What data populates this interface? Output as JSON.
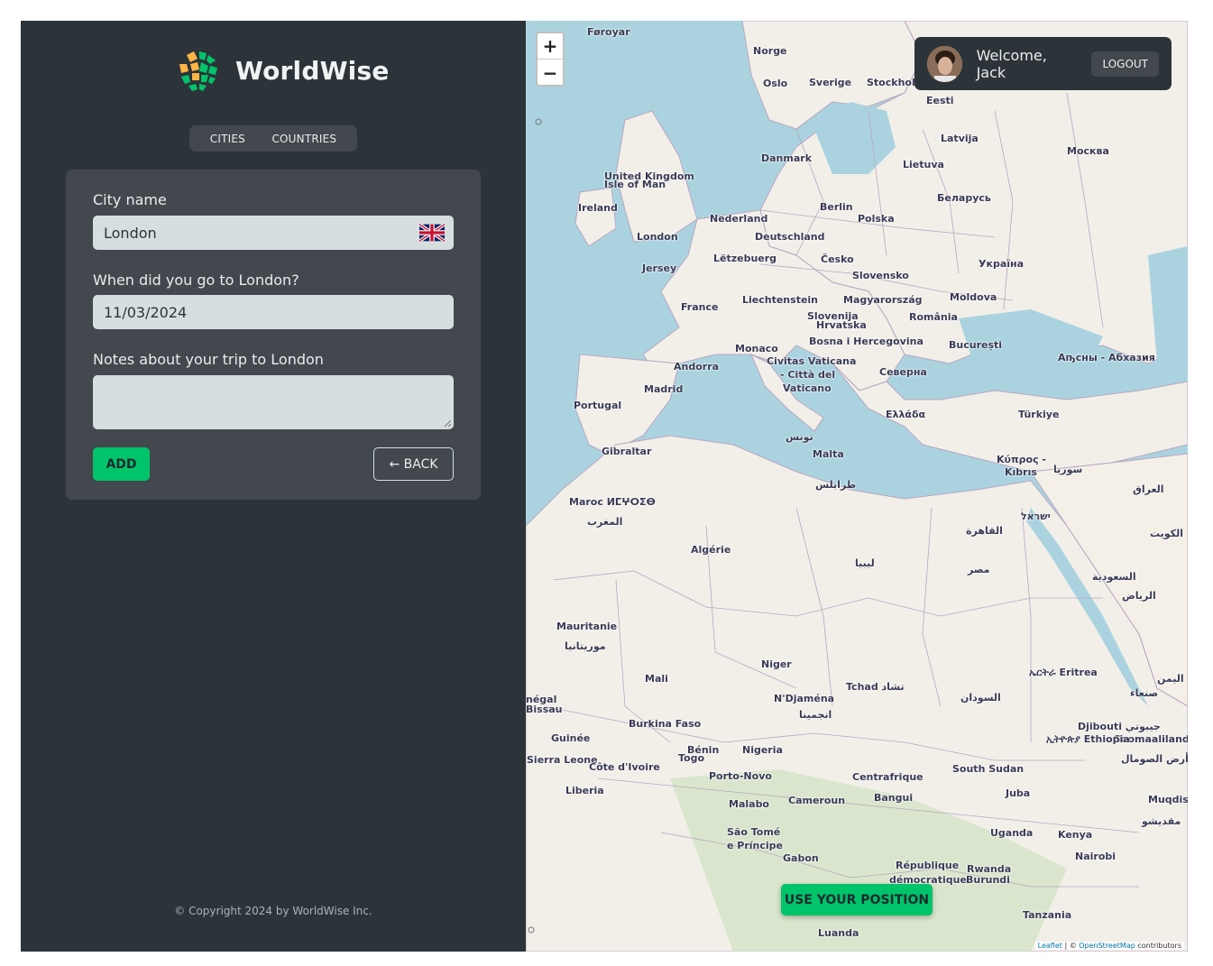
{
  "app": {
    "brand": "WorldWise",
    "nav": {
      "cities": "CITIES",
      "countries": "COUNTRIES"
    },
    "copyright": "© Copyright 2024 by WorldWise Inc."
  },
  "form": {
    "city_label": "City name",
    "city_value": "London",
    "date_label": "When did you go to London?",
    "date_value": "11/03/2024",
    "notes_label": "Notes about your trip to London",
    "notes_value": "",
    "add_button": "ADD",
    "back_button": "← BACK"
  },
  "user": {
    "welcome": "Welcome, Jack",
    "logout": "LOGOUT"
  },
  "map": {
    "zoom_in": "+",
    "zoom_out": "−",
    "use_position": "USE YOUR POSITION",
    "attribution_leaflet": "Leaflet",
    "attribution_sep": " | © ",
    "attribution_osm": "OpenStreetMap",
    "attribution_tail": " contributors",
    "labels": [
      {
        "text": "Føroyar"
      },
      {
        "text": "Norge"
      },
      {
        "text": "Sverige"
      },
      {
        "text": "Stockholm"
      },
      {
        "text": "Oslo"
      },
      {
        "text": "Eesti"
      },
      {
        "text": "Latvija"
      },
      {
        "text": "Lietuva"
      },
      {
        "text": "Москва"
      },
      {
        "text": "Danmark"
      },
      {
        "text": "United Kingdom"
      },
      {
        "text": "Isle of Man"
      },
      {
        "text": "Ireland"
      },
      {
        "text": "Nederland"
      },
      {
        "text": "Berlin"
      },
      {
        "text": "Polska"
      },
      {
        "text": "Беларусь"
      },
      {
        "text": "London"
      },
      {
        "text": "Deutschland"
      },
      {
        "text": "Jersey"
      },
      {
        "text": "Lëtzebuerg"
      },
      {
        "text": "Česko"
      },
      {
        "text": "Україна"
      },
      {
        "text": "Slovensko"
      },
      {
        "text": "France"
      },
      {
        "text": "Liechtenstein"
      },
      {
        "text": "Magyarország"
      },
      {
        "text": "Moldova"
      },
      {
        "text": "Slovenija"
      },
      {
        "text": "Hrvatska"
      },
      {
        "text": "România"
      },
      {
        "text": "Monaco"
      },
      {
        "text": "Bosna i Hercegovina"
      },
      {
        "text": "București"
      },
      {
        "text": "Andorra"
      },
      {
        "text": "Civitas Vaticana"
      },
      {
        "text": "- Città del"
      },
      {
        "text": "Vaticano"
      },
      {
        "text": "Северна"
      },
      {
        "text": "Madrid"
      },
      {
        "text": "Portugal"
      },
      {
        "text": "Ελλάδα"
      },
      {
        "text": "Türkiye"
      },
      {
        "text": "Аҧсны - Абхазия"
      },
      {
        "text": "Gibraltar"
      },
      {
        "text": "تونس"
      },
      {
        "text": "Malta"
      },
      {
        "text": "Κύπρος -"
      },
      {
        "text": "Kıbrıs"
      },
      {
        "text": "سوريا"
      },
      {
        "text": "العراق"
      },
      {
        "text": "طرابلس"
      },
      {
        "text": "Maroc ⵍⵎⵖⵔⵉⴱ"
      },
      {
        "text": "المغرب"
      },
      {
        "text": "ישראל"
      },
      {
        "text": "القاهرة"
      },
      {
        "text": "الكويت"
      },
      {
        "text": "Algérie"
      },
      {
        "text": "ليبيا"
      },
      {
        "text": "مصر"
      },
      {
        "text": "السعودية"
      },
      {
        "text": "الرياض"
      },
      {
        "text": "Mauritanie"
      },
      {
        "text": "موريتانيا"
      },
      {
        "text": "Niger"
      },
      {
        "text": "Mali"
      },
      {
        "text": "Tchad تشاد"
      },
      {
        "text": "N'Djaména"
      },
      {
        "text": "انجمينا"
      },
      {
        "text": "ኤርትራ Eritrea"
      },
      {
        "text": "اليمن"
      },
      {
        "text": "السودان"
      },
      {
        "text": "صنعاء"
      },
      {
        "text": "Burkina Faso"
      },
      {
        "text": "Djibouti جيبوتي"
      },
      {
        "text": "Soomaaliland"
      },
      {
        "text": "Guinée"
      },
      {
        "text": "Bénin"
      },
      {
        "text": "Nigeria"
      },
      {
        "text": "ኢትዮጵያ Ethiopia"
      },
      {
        "text": "Togo"
      },
      {
        "text": "Sierra Leone"
      },
      {
        "text": "Côte d'Ivoire"
      },
      {
        "text": "أرض الصومال"
      },
      {
        "text": "Porto-Novo"
      },
      {
        "text": "Centrafrique"
      },
      {
        "text": "South Sudan"
      },
      {
        "text": "Liberia"
      },
      {
        "text": "Bangui"
      },
      {
        "text": "Juba"
      },
      {
        "text": "Muqdisho"
      },
      {
        "text": "Malabo"
      },
      {
        "text": "Cameroun"
      },
      {
        "text": "São Tomé"
      },
      {
        "text": "e Príncipe"
      },
      {
        "text": "Uganda"
      },
      {
        "text": "Kenya"
      },
      {
        "text": "مقديشو"
      },
      {
        "text": "Gabon"
      },
      {
        "text": "Nairobi"
      },
      {
        "text": "République"
      },
      {
        "text": "démocratique"
      },
      {
        "text": "Rwanda"
      },
      {
        "text": "Burundi"
      },
      {
        "text": "Tanzania"
      },
      {
        "text": "Luanda"
      },
      {
        "text": "négal"
      },
      {
        "text": "Bissau"
      }
    ]
  }
}
